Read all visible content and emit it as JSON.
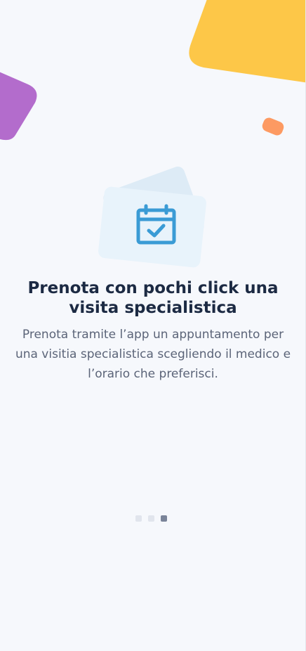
{
  "onboarding": {
    "title": "Prenota con pochi click una visita specialistica",
    "description": "Prenota tramite l’app un appuntamento per una visitia specialistica scegliendo il medico e l’orario che preferisci.",
    "illustration_icon": "calendar-check-icon",
    "pager": {
      "total_pages": 3,
      "active_page": 3
    }
  },
  "colors": {
    "background": "#f6f8fc",
    "title": "#1c2a43",
    "description": "#5b6478",
    "accent_blue": "#3a9bd5",
    "card_blue": "#e8f3fb",
    "deco_yellow": "#fdc748",
    "deco_purple": "#b36ccc",
    "deco_orange": "#fd9a62",
    "dot_inactive": "#e1e5ed",
    "dot_active": "#7a8499"
  }
}
